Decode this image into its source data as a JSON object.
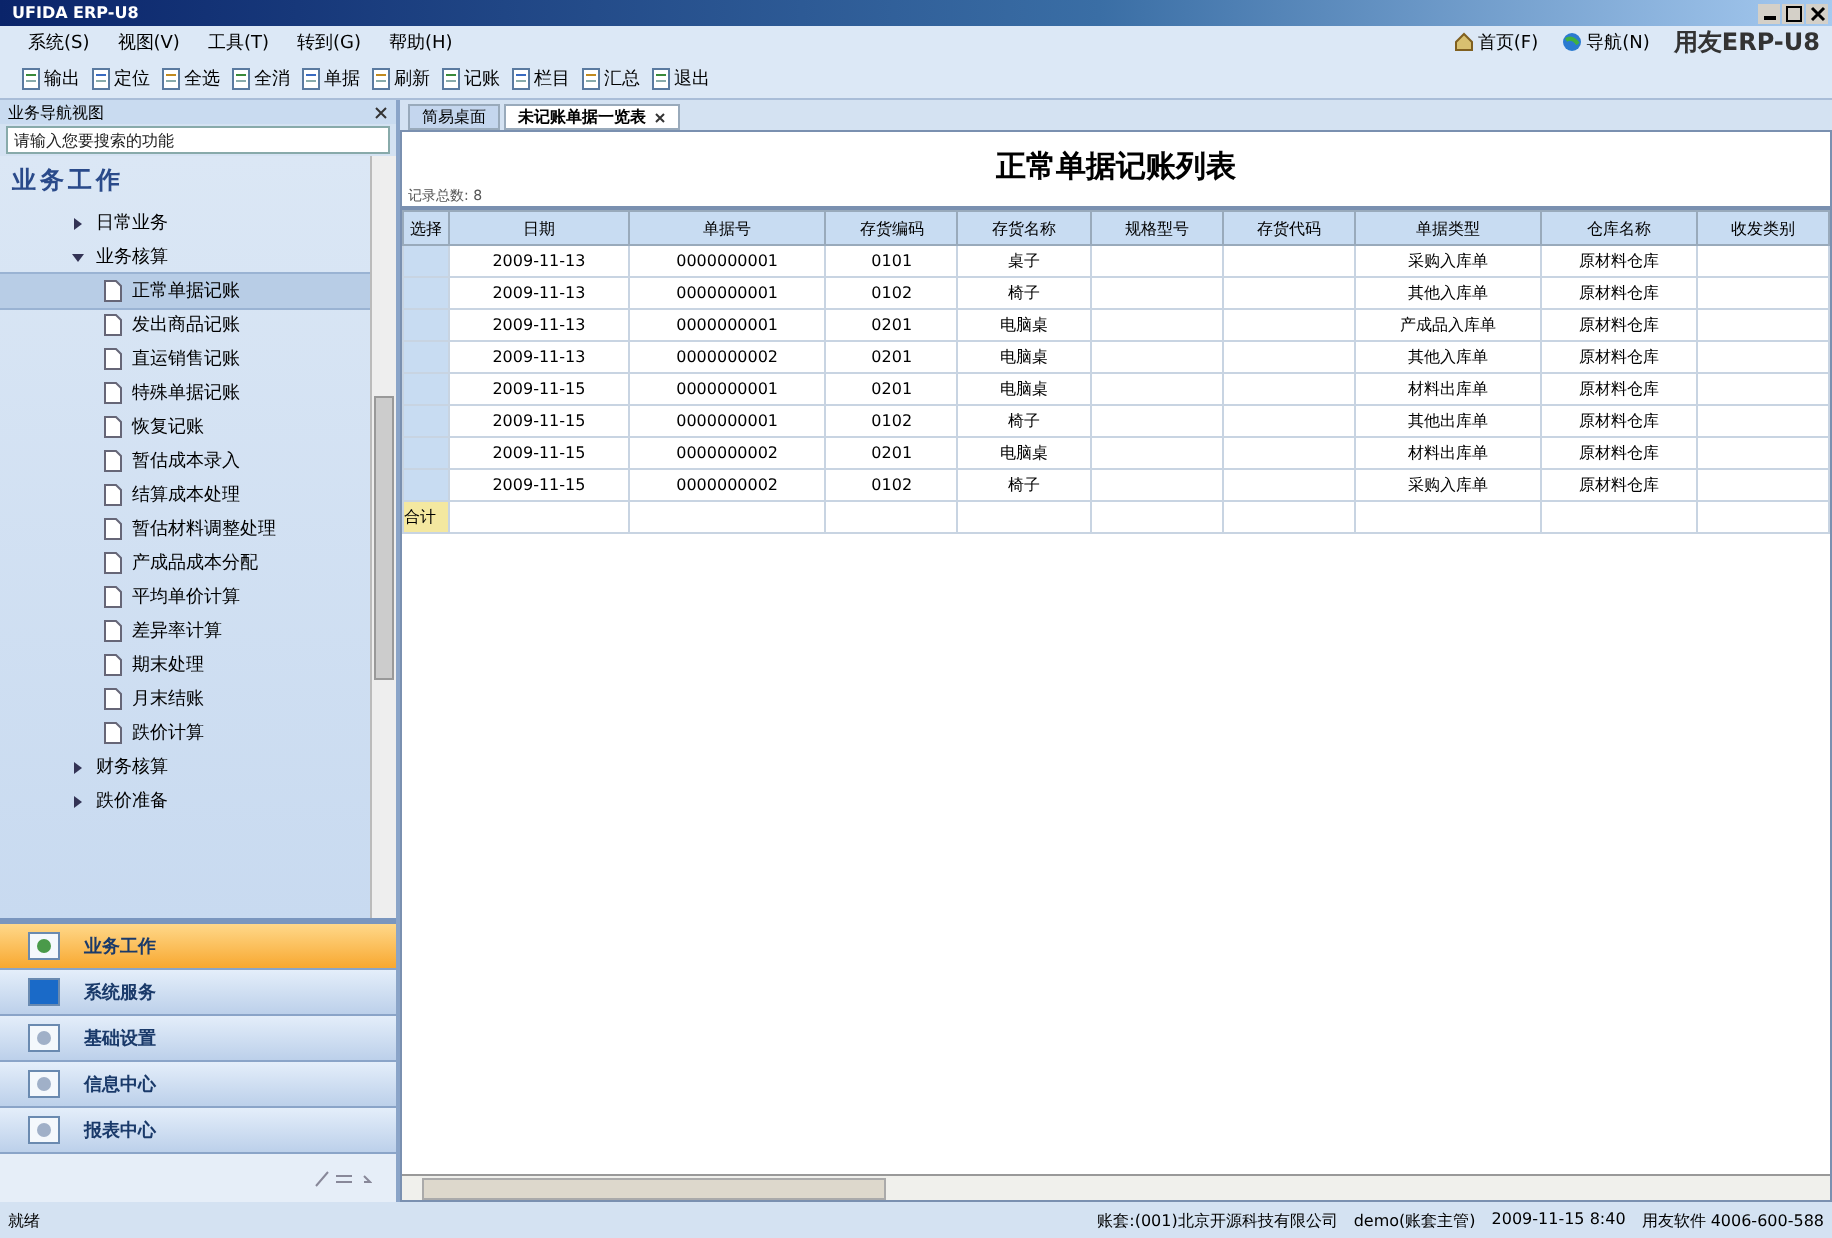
{
  "window": {
    "title": "UFIDA ERP-U8"
  },
  "menu": [
    "系统(S)",
    "视图(V)",
    "工具(T)",
    "转到(G)",
    "帮助(H)"
  ],
  "toolbar": [
    "输出",
    "定位",
    "全选",
    "全消",
    "单据",
    "刷新",
    "记账",
    "栏目",
    "汇总",
    "退出"
  ],
  "top_links": [
    {
      "label": "首页(F)"
    },
    {
      "label": "导航(N)"
    }
  ],
  "brand": "用友ERP-U8",
  "sidebar": {
    "title": "业务导航视图",
    "search": {
      "placeholder": "请输入您要搜索的功能"
    },
    "heading": "业务工作",
    "tree": [
      {
        "label": "日常业务",
        "expanded": false,
        "selected": false
      },
      {
        "label": "业务核算",
        "expanded": true,
        "selected": false,
        "children": [
          {
            "label": "正常单据记账",
            "selected": true
          },
          {
            "label": "发出商品记账",
            "selected": false
          },
          {
            "label": "直运销售记账",
            "selected": false
          },
          {
            "label": "特殊单据记账",
            "selected": false
          },
          {
            "label": "恢复记账",
            "selected": false
          },
          {
            "label": "暂估成本录入",
            "selected": false
          },
          {
            "label": "结算成本处理",
            "selected": false
          },
          {
            "label": "暂估材料调整处理",
            "selected": false
          },
          {
            "label": "产成品成本分配",
            "selected": false
          },
          {
            "label": "平均单价计算",
            "selected": false
          },
          {
            "label": "差异率计算",
            "selected": false
          },
          {
            "label": "期末处理",
            "selected": false
          },
          {
            "label": "月末结账",
            "selected": false
          },
          {
            "label": "跌价计算",
            "selected": false
          }
        ]
      },
      {
        "label": "财务核算",
        "expanded": false,
        "selected": false
      },
      {
        "label": "跌价准备",
        "expanded": false,
        "selected": false
      }
    ],
    "nav": [
      {
        "label": "业务工作",
        "selected": true
      },
      {
        "label": "系统服务",
        "selected": false
      },
      {
        "label": "基础设置",
        "selected": false
      },
      {
        "label": "信息中心",
        "selected": false
      },
      {
        "label": "报表中心",
        "selected": false
      }
    ]
  },
  "tabs": [
    {
      "label": "简易桌面",
      "selected": false
    },
    {
      "label": "未记账单据一览表",
      "selected": true
    }
  ],
  "report": {
    "title": "正常单据记账列表",
    "count": "记录总数: 8",
    "columns": [
      "选择",
      "日期",
      "单据号",
      "存货编码",
      "存货名称",
      "规格型号",
      "存货代码",
      "单据类型",
      "仓库名称",
      "收发类别"
    ],
    "rows": [
      [
        "",
        "2009-11-13",
        "0000000001",
        "0101",
        "桌子",
        "",
        "",
        "采购入库单",
        "原材料仓库",
        ""
      ],
      [
        "",
        "2009-11-13",
        "0000000001",
        "0102",
        "椅子",
        "",
        "",
        "其他入库单",
        "原材料仓库",
        ""
      ],
      [
        "",
        "2009-11-13",
        "0000000001",
        "0201",
        "电脑桌",
        "",
        "",
        "产成品入库单",
        "原材料仓库",
        ""
      ],
      [
        "",
        "2009-11-13",
        "0000000002",
        "0201",
        "电脑桌",
        "",
        "",
        "其他入库单",
        "原材料仓库",
        ""
      ],
      [
        "",
        "2009-11-15",
        "0000000001",
        "0201",
        "电脑桌",
        "",
        "",
        "材料出库单",
        "原材料仓库",
        ""
      ],
      [
        "",
        "2009-11-15",
        "0000000001",
        "0102",
        "椅子",
        "",
        "",
        "其他出库单",
        "原材料仓库",
        ""
      ],
      [
        "",
        "2009-11-15",
        "0000000002",
        "0201",
        "电脑桌",
        "",
        "",
        "材料出库单",
        "原材料仓库",
        ""
      ],
      [
        "",
        "2009-11-15",
        "0000000002",
        "0102",
        "椅子",
        "",
        "",
        "采购入库单",
        "原材料仓库",
        ""
      ]
    ],
    "total_label": "合计"
  },
  "status_bar": {
    "left": "就绪",
    "items": [
      "账套:(001)北京开源科技有限公司",
      "demo(账套主管)",
      "2009-11-15 8:40",
      "用友软件 4006-600-588"
    ]
  }
}
